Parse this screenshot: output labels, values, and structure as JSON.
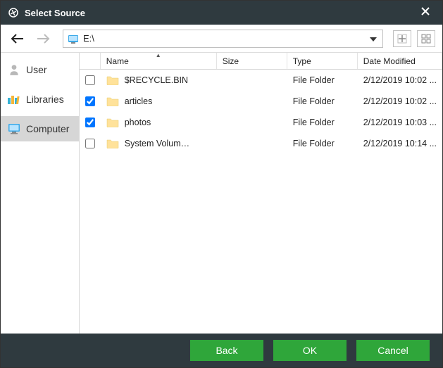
{
  "title": "Select Source",
  "path": "E:\\",
  "sidebar": [
    {
      "label": "User",
      "icon": "user",
      "selected": false
    },
    {
      "label": "Libraries",
      "icon": "libraries",
      "selected": false
    },
    {
      "label": "Computer",
      "icon": "computer",
      "selected": true
    }
  ],
  "columns": {
    "name": "Name",
    "size": "Size",
    "type": "Type",
    "date": "Date Modified"
  },
  "rows": [
    {
      "checked": false,
      "name": "$RECYCLE.BIN",
      "size": "",
      "type": "File Folder",
      "date": "2/12/2019 10:02 ..."
    },
    {
      "checked": true,
      "name": "articles",
      "size": "",
      "type": "File Folder",
      "date": "2/12/2019 10:02 ..."
    },
    {
      "checked": true,
      "name": "photos",
      "size": "",
      "type": "File Folder",
      "date": "2/12/2019 10:03 ..."
    },
    {
      "checked": false,
      "name": "System Volum…",
      "size": "",
      "type": "File Folder",
      "date": "2/12/2019 10:14 ..."
    }
  ],
  "buttons": {
    "back": "Back",
    "ok": "OK",
    "cancel": "Cancel"
  }
}
